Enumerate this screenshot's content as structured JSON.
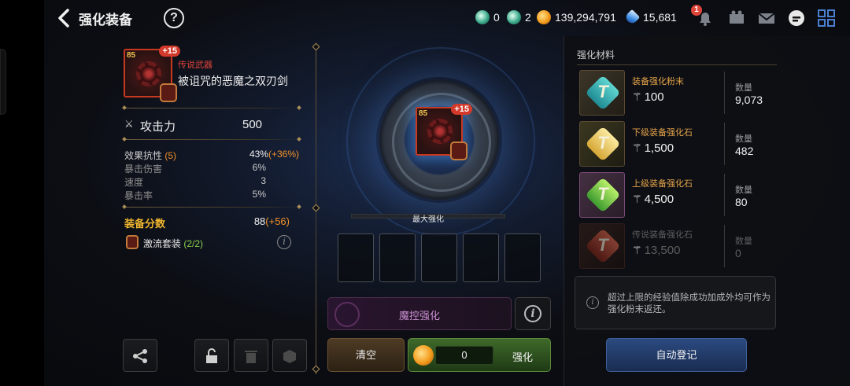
{
  "header": {
    "title": "强化装备",
    "currencies": [
      {
        "icon": "green-token-icon",
        "value": "0"
      },
      {
        "icon": "green-gem-icon",
        "value": "2"
      },
      {
        "icon": "gold-coin-icon",
        "value": "139,294,791"
      },
      {
        "icon": "blue-crystal-icon",
        "value": "15,681"
      }
    ],
    "notification_badge": "1"
  },
  "item": {
    "level": "85",
    "enhance_level": "+15",
    "rarity": "传说武器",
    "name": "被诅咒的恶魔之双刃剑"
  },
  "attack": {
    "label": "攻击力",
    "value": "500"
  },
  "stats": [
    {
      "name": "效果抗性",
      "count": "(5)",
      "value": "43%",
      "bonus": "(+36%)"
    },
    {
      "name": "暴击伤害",
      "value": "6%"
    },
    {
      "name": "速度",
      "value": "3"
    },
    {
      "name": "暴击率",
      "value": "5%"
    }
  ],
  "score": {
    "label": "装备分数",
    "value": "88",
    "bonus": "(+56)"
  },
  "set": {
    "name": "激流套装",
    "count": "(2/2)"
  },
  "center": {
    "max_label": "最大强化",
    "magic_label": "魔控强化",
    "clear_label": "清空",
    "cost_value": "0",
    "enhance_label": "强化"
  },
  "materials": {
    "title": "强化材料",
    "qty_label": "数量",
    "items": [
      {
        "name": "装备强化粉末",
        "value": "100",
        "qty": "9,073",
        "letter": "T"
      },
      {
        "name": "下级装备强化石",
        "value": "1,500",
        "qty": "482",
        "letter": "T"
      },
      {
        "name": "上级装备强化石",
        "value": "4,500",
        "qty": "80",
        "letter": "T"
      },
      {
        "name": "传说装备强化石",
        "value": "13,500",
        "qty": "0",
        "letter": "T"
      }
    ]
  },
  "notice": "超过上限的经验值除成功加成外均可作为强化粉末返还。",
  "auto_label": "自动登记"
}
